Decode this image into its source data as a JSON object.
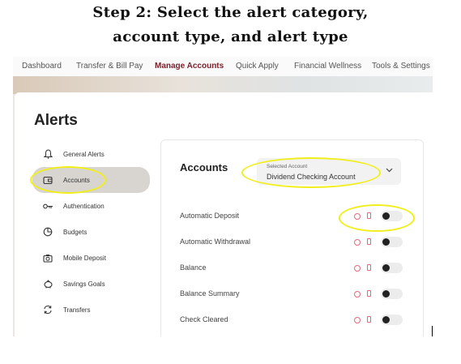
{
  "heading": {
    "line1": "Step 2: Select the alert category,",
    "line2": "account type, and alert type"
  },
  "nav": {
    "items": [
      {
        "label": "Dashboard",
        "active": false
      },
      {
        "label": "Transfer & Bill Pay",
        "active": false
      },
      {
        "label": "Manage Accounts",
        "active": true
      },
      {
        "label": "Quick Apply",
        "active": false
      },
      {
        "label": "Financial Wellness",
        "active": false
      },
      {
        "label": "Tools & Settings",
        "active": false
      }
    ]
  },
  "page": {
    "title": "Alerts"
  },
  "sidebar": {
    "items": [
      {
        "label": "General Alerts",
        "icon": "bell-icon",
        "active": false
      },
      {
        "label": "Accounts",
        "icon": "wallet-icon",
        "active": true
      },
      {
        "label": "Authentication",
        "icon": "key-icon",
        "active": false
      },
      {
        "label": "Budgets",
        "icon": "pie-chart-icon",
        "active": false
      },
      {
        "label": "Mobile Deposit",
        "icon": "camera-icon",
        "active": false
      },
      {
        "label": "Savings Goals",
        "icon": "piggy-bank-icon",
        "active": false
      },
      {
        "label": "Transfers",
        "icon": "transfer-icon",
        "active": false
      }
    ]
  },
  "panel": {
    "title": "Accounts",
    "select": {
      "caption": "Selected Account",
      "value": "Dividend Checking Account"
    },
    "alerts": [
      {
        "label": "Automatic Deposit",
        "enabled": false
      },
      {
        "label": "Automatic Withdrawal",
        "enabled": false
      },
      {
        "label": "Balance",
        "enabled": false
      },
      {
        "label": "Balance Summary",
        "enabled": false
      },
      {
        "label": "Check Cleared",
        "enabled": false
      }
    ]
  },
  "colors": {
    "highlight": "#f1ef1b",
    "nav_active": "#7a1f2b",
    "channel_icon": "#e06a7a"
  }
}
